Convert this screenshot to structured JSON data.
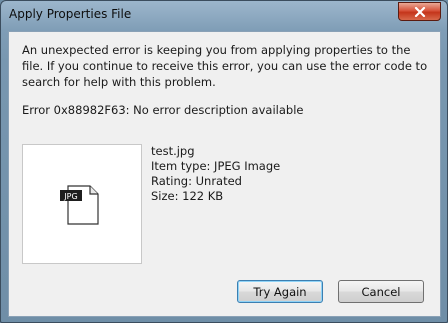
{
  "window": {
    "title": "Apply Properties File"
  },
  "dialog": {
    "message": "An unexpected error is keeping you from applying properties to the file. If you continue to receive this error, you can use the error code to search for help with this problem.",
    "error": "Error 0x88982F63: No error description available",
    "file": {
      "name": "test.jpg",
      "item_type": "Item type: JPEG Image",
      "rating": "Rating: Unrated",
      "size": "Size: 122 KB",
      "icon_badge": "JPG",
      "icon": "jpg-file-icon"
    }
  },
  "buttons": {
    "try_again": "Try Again",
    "cancel": "Cancel"
  },
  "colors": {
    "accent": "#3c7fb1",
    "close": "#c4351b",
    "title_bar": "#7f9db6"
  }
}
